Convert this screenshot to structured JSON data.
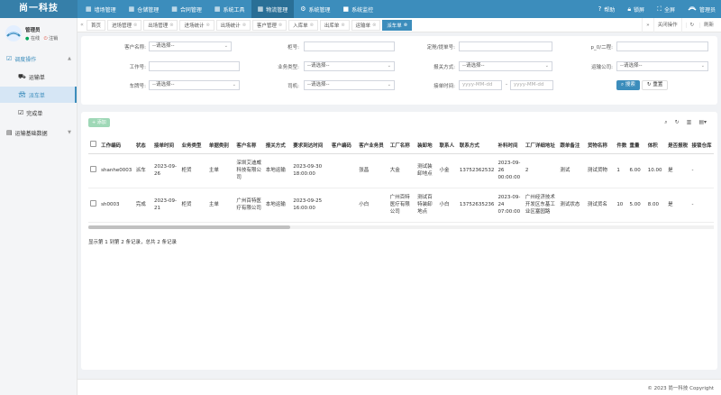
{
  "app": {
    "logo_text": "尚一科技"
  },
  "topnav": [
    {
      "label": "墙场管理",
      "icon": "grid-icon"
    },
    {
      "label": "仓储管理",
      "icon": "grid-icon"
    },
    {
      "label": "合同管理",
      "icon": "grid-icon"
    },
    {
      "label": "系统工具",
      "icon": "grid-icon"
    },
    {
      "label": "物流管理",
      "icon": "grid-icon"
    },
    {
      "label": "系统管理",
      "icon": "gear-icon"
    },
    {
      "label": "系统监控",
      "icon": "video-icon"
    }
  ],
  "topright": {
    "help": "帮助",
    "lock": "锁屏",
    "fullscreen": "全屏",
    "user": "管理员"
  },
  "sidebar": {
    "user_name": "管理员",
    "status_online": "在线",
    "logout": "注销",
    "group_label": "调度操作",
    "items": [
      "运输单",
      "派车单",
      "完成单"
    ],
    "group2_label": "运输基础数据"
  },
  "tabs": [
    {
      "label": "首页"
    },
    {
      "label": "进场管理"
    },
    {
      "label": "出场管理"
    },
    {
      "label": "进场统计"
    },
    {
      "label": "出场统计"
    },
    {
      "label": "客户管理"
    },
    {
      "label": "入库单"
    },
    {
      "label": "出库单"
    },
    {
      "label": "运输单"
    },
    {
      "label": "派车单"
    }
  ],
  "tab_tools": {
    "close_ops": "关闭操作",
    "refresh": "刷新"
  },
  "search": {
    "customer_label": "客户名称:",
    "customer_value": "--请选择--",
    "box_label": "柜号:",
    "box_value": "",
    "booking_label": "定舱/提单号:",
    "booking_value": "",
    "pod_label": "p_0/二程:",
    "pod_value": "",
    "work_label": "工作号:",
    "work_value": "",
    "biz_label": "业务类型:",
    "biz_value": "--请选择--",
    "customs_label": "报关方式:",
    "customs_value": "--请选择--",
    "carrier_label": "运输公司:",
    "carrier_value": "--请选择--",
    "plate_label": "车牌号:",
    "plate_value": "--请选择--",
    "driver_label": "司机:",
    "driver_value": "--请选择--",
    "time_label": "接单时间:",
    "time_from": "yyyy-MM-dd",
    "time_sep": "-",
    "time_to": "yyyy-MM-dd",
    "search_btn": "搜索",
    "reset_btn": "重置"
  },
  "toolbar": {
    "add": "+ 添加"
  },
  "table": {
    "headers": [
      "工作编码",
      "状态",
      "接单时间",
      "业务类型",
      "单据类别",
      "客户名称",
      "报关方式",
      "要求到达时间",
      "客户编码",
      "客户业务员",
      "工厂名称",
      "装卸地",
      "联系人",
      "联系方式",
      "补料时间",
      "工厂详细地址",
      "跟单备注",
      "货物名称",
      "件数",
      "重量",
      "体积",
      "是否报税",
      "接锁仓库"
    ],
    "rows": [
      [
        "shanhe0003",
        "派车",
        "2023-09-26",
        "柜货",
        "主单",
        "深圳艾迪威科技有限公司",
        "本地运输",
        "2023-09-30 18:00:00",
        "",
        "张昌",
        "大金",
        "测试装卸地点",
        "小金",
        "13752362532",
        "2023-09-26 00:00:00",
        "2",
        "测试",
        "测试货物",
        "1",
        "6.00",
        "10.00",
        "是",
        "-"
      ],
      [
        "sh0003",
        "完成",
        "2023-09-21",
        "柜货",
        "主单",
        "广州百特医疗有限公司",
        "本地运输",
        "2023-09-25 16:00:00",
        "",
        "小白",
        "广州百特医疗有限公司",
        "测试百特装卸地点",
        "小白",
        "13752635236",
        "2023-09-24 07:00:00",
        "广州经济技术开发区东基工业区塞园路",
        "测试状态",
        "测试货名",
        "10",
        "5.00",
        "8.00",
        "是",
        "-"
      ]
    ]
  },
  "pagination": {
    "info": "显示第 1 到第 2 条记录，总共 2 条记录"
  },
  "footer": {
    "copyright": "© 2023 尚一科技 Copyright"
  }
}
